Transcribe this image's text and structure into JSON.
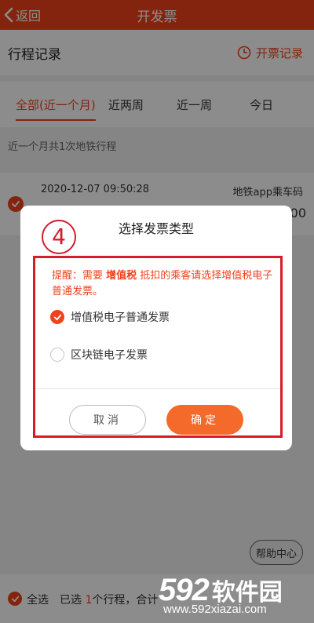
{
  "header": {
    "back_label": "返回",
    "title": "开发票"
  },
  "section": {
    "title": "行程记录",
    "record_link": "开票记录"
  },
  "tabs": [
    {
      "label": "全部(近一个月)",
      "active": true
    },
    {
      "label": "近两周",
      "active": false
    },
    {
      "label": "近一周",
      "active": false
    },
    {
      "label": "今日",
      "active": false
    }
  ],
  "summary": "近一个月共1次地铁行程",
  "trip": {
    "datetime": "2020-12-07 09:50:28",
    "type": "地铁app乘车码",
    "amount": "00"
  },
  "dialog": {
    "step": "4",
    "title": "选择发票类型",
    "notice_prefix": "提醒：需要 ",
    "notice_bold": "增值税",
    "notice_suffix": " 抵扣的乘客请选择增值税电子普通发票。",
    "options": [
      {
        "label": "增值税电子普通发票",
        "selected": true
      },
      {
        "label": "区块链电子发票",
        "selected": false
      }
    ],
    "cancel_label": "取消",
    "confirm_label": "确定"
  },
  "help_label": "帮助中心",
  "bottom": {
    "select_all": "全选",
    "selected_prefix": "已选 ",
    "selected_count": "1",
    "selected_suffix": "个行程，合计"
  },
  "watermark": {
    "number": "592",
    "name": "软件园",
    "url": "www.592xiazai.com"
  },
  "colors": {
    "brand": "#f0431c",
    "annotation": "#d41c2a",
    "confirm": "#f36a2b"
  }
}
